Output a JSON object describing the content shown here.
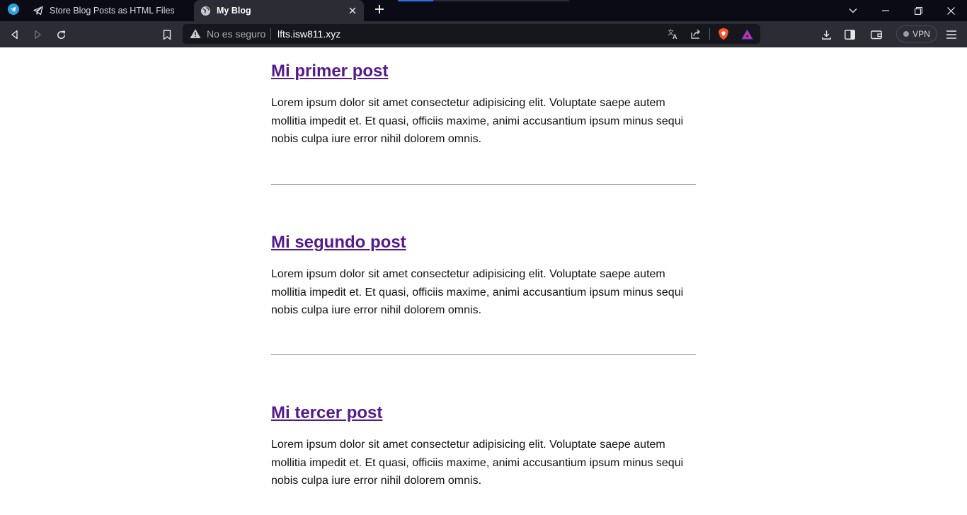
{
  "browser": {
    "tabs": [
      {
        "label": "Store Blog Posts as HTML Files",
        "active": false
      },
      {
        "label": "My Blog",
        "active": true
      }
    ],
    "omnibox": {
      "security_text": "No es seguro",
      "url": "lfts.isw811.xyz"
    },
    "vpn_label": "VPN"
  },
  "blog": {
    "posts": [
      {
        "title": "Mi primer post",
        "excerpt": "Lorem ipsum dolor sit amet consectetur adipisicing elit. Voluptate saepe autem mollitia impedit et. Et quasi, officiis maxime, animi accusantium ipsum minus sequi nobis culpa iure error nihil dolorem omnis."
      },
      {
        "title": "Mi segundo post",
        "excerpt": "Lorem ipsum dolor sit amet consectetur adipisicing elit. Voluptate saepe autem mollitia impedit et. Et quasi, officiis maxime, animi accusantium ipsum minus sequi nobis culpa iure error nihil dolorem omnis."
      },
      {
        "title": "Mi tercer post",
        "excerpt": "Lorem ipsum dolor sit amet consectetur adipisicing elit. Voluptate saepe autem mollitia impedit et. Et quasi, officiis maxime, animi accusantium ipsum minus sequi nobis culpa iure error nihil dolorem omnis."
      }
    ]
  },
  "colors": {
    "link_visited": "#551a8b",
    "tabstrip_bg": "#0b0b16",
    "toolbar_bg": "#2b2c34",
    "brave_orange": "#fb542b"
  }
}
